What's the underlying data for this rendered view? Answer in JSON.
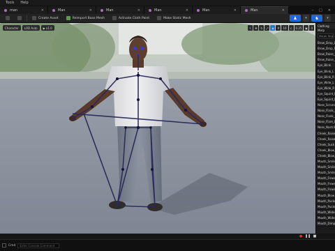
{
  "menubar": {
    "items": [
      "Tools",
      "Help"
    ]
  },
  "tabs": [
    {
      "label": "man",
      "active": false
    },
    {
      "label": "Man",
      "active": false
    },
    {
      "label": "Man",
      "active": false
    },
    {
      "label": "Man",
      "active": false
    },
    {
      "label": "Man",
      "active": false
    },
    {
      "label": "Man",
      "active": true
    }
  ],
  "toolbar": {
    "create_asset": "Create Asset",
    "reimport": "Reimport Base Mesh",
    "activate_cloth": "Activate Cloth Paint",
    "make_static": "Make Static Mesh"
  },
  "viewport": {
    "character_btn": "Character",
    "lod_btn": "LOD Auto",
    "play_speed": "x1.0",
    "right_value_1": "10",
    "right_value_2": "0.25",
    "right_value_3": "4"
  },
  "morph_panel": {
    "title": "Clothing",
    "subtitle": "Morp",
    "search_placeholder": "Morph Targets",
    "items": [
      "Brow_Drop_L",
      "Brow_Drop_R",
      "Brow_Raise_I",
      "Brow_Raise_O",
      "Eye_Blink",
      "Eye_Blink_L",
      "Eye_Blink_R",
      "Eye_Wide_L",
      "Eye_Wide_R",
      "Eye_Squint_L",
      "Eye_Squint_R",
      "Nose_Scrunch",
      "Nose_Flank_L",
      "Nose_Flank_R",
      "Nose_Flare_L",
      "Nose_Nostrils",
      "Cheek_Raise_L",
      "Cheek_Raise_R",
      "Cheek_Suck",
      "Cheek_Blow_L",
      "Cheek_Blow_R",
      "Mouth_Smile",
      "Mouth_Smile_L",
      "Mouth_Smile_R",
      "Mouth_Frown",
      "Mouth_Frown_L",
      "Mouth_Frown_R",
      "Mouth_Blow",
      "Mouth_Pucker",
      "Mouth_Pucker_L",
      "Mouth_Widen",
      "Mouth_Widen_L",
      "Mouth_Dimple"
    ]
  },
  "statusbar": {
    "cmd_label": "Cmd",
    "cmd_placeholder": "Enter Console Command"
  },
  "colors": {
    "accent": "#1d6ad1",
    "tab_dot": "#b06ac0",
    "skeleton": "#2a2a5a"
  }
}
